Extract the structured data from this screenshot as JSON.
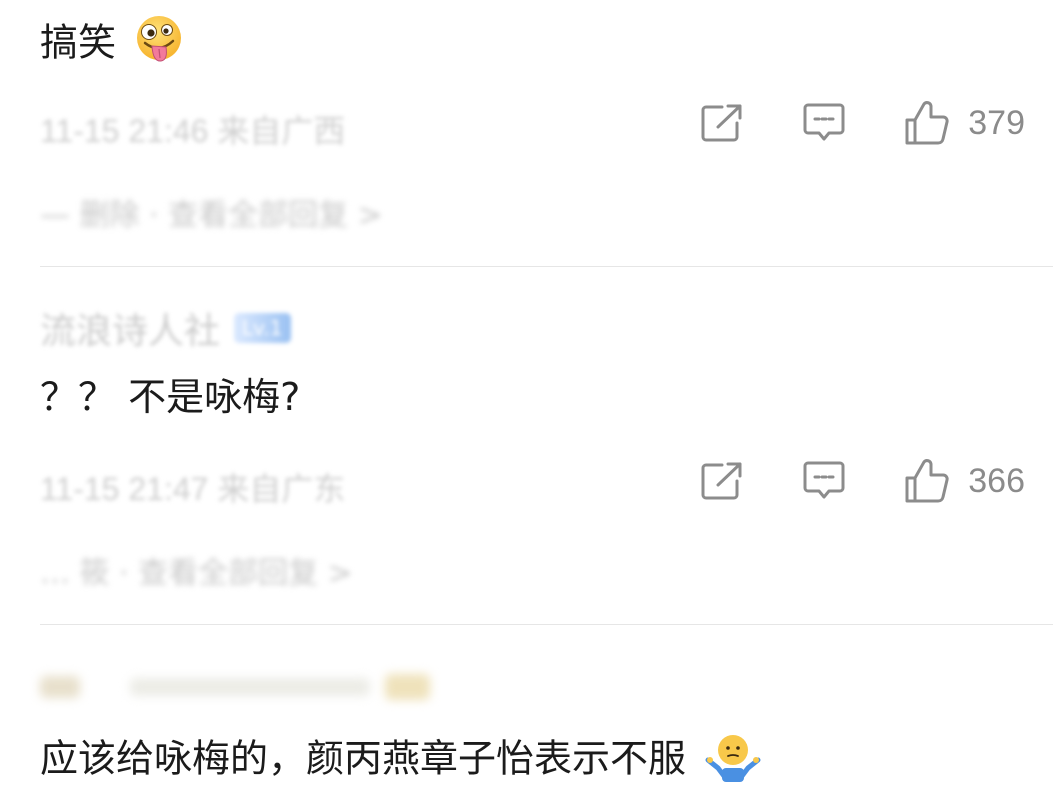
{
  "comments": [
    {
      "text": "搞笑",
      "emoji": "crazy-face",
      "meta": "11-15 21:46 来自广西",
      "likes": "379",
      "replies_preview": "— 删除 · 查看全部回复 >"
    },
    {
      "username": "流浪诗人社",
      "badge": "Lv.1",
      "text": "？？ 不是咏梅?",
      "meta": "11-15 21:47 来自广东",
      "likes": "366",
      "replies_preview": "… 筱 · 查看全部回复 >"
    },
    {
      "text": "应该给咏梅的，颜丙燕章子怡表示不服",
      "emoji": "shrug"
    }
  ],
  "icons": {
    "share": "share-icon",
    "comment": "comment-icon",
    "like": "thumbs-up-icon"
  },
  "colors": {
    "icon": "#8c8c8c",
    "divider": "#e6e6e6",
    "badge_start": "#dbe9ff",
    "badge_end": "#9ac1f2"
  }
}
